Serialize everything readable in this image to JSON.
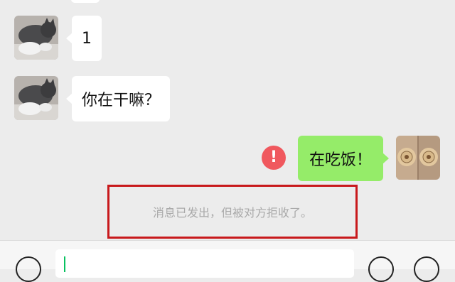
{
  "messages": [
    {
      "side": "incoming",
      "text": "1",
      "avatar_icon": "cat-avatar-icon"
    },
    {
      "side": "incoming",
      "text": "你在干嘛？",
      "avatar_icon": "cat-avatar-icon"
    },
    {
      "side": "outgoing",
      "text": "在吃饭！",
      "avatar_icon": "cookie-avatar-icon",
      "status_icon": "send-failed-exclamation-icon",
      "status_symbol": "!"
    }
  ],
  "system_notice": "消息已发出，但被对方拒收了。",
  "input_bar": {
    "value": "",
    "icons": [
      "voice-icon",
      "emoji-icon",
      "plus-icon"
    ]
  },
  "colors": {
    "background": "#ececec",
    "incoming_bubble": "#ffffff",
    "outgoing_bubble": "#95ec69",
    "error": "#f0585e",
    "highlight_box": "#c8191c",
    "notice_text": "#a9a9a9"
  }
}
